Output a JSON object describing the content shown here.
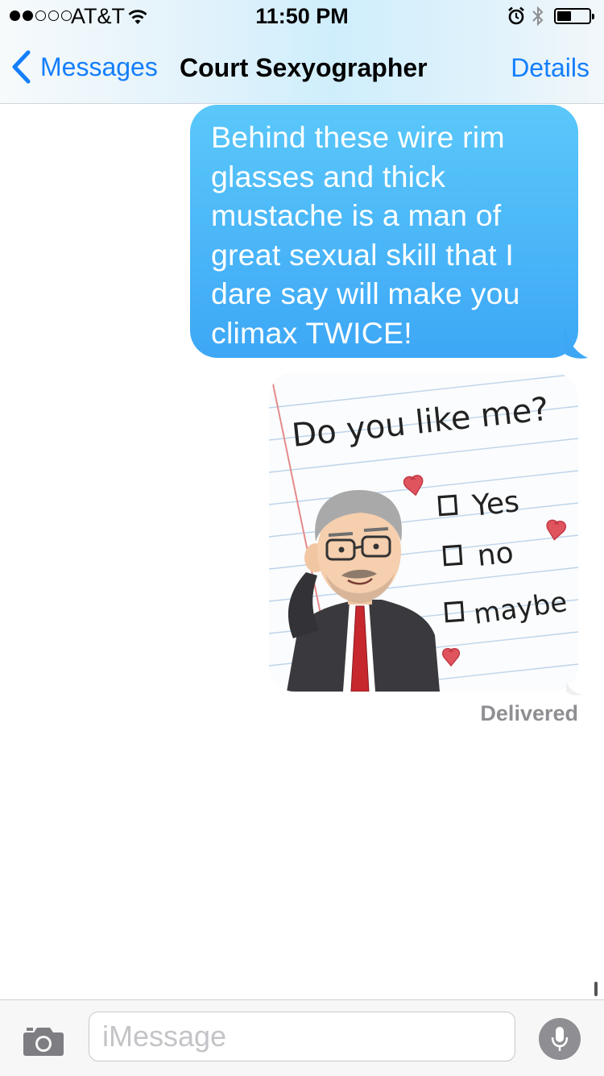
{
  "status_bar": {
    "carrier": "AT&T",
    "signal_bars": 2,
    "signal_total": 5,
    "time": "11:50 PM",
    "battery_level": 0.45,
    "icons": [
      "wifi-icon",
      "alarm-icon",
      "bluetooth-icon",
      "battery-icon"
    ]
  },
  "nav": {
    "back_label": "Messages",
    "title": "Court Sexyographer",
    "details_label": "Details"
  },
  "messages": [
    {
      "type": "text",
      "direction": "outgoing",
      "lines": [
        "Behind these wire rim",
        "glasses and thick",
        "mustache is a man of",
        "great sexual skill that I",
        "dare say will make you",
        "climax TWICE!"
      ]
    },
    {
      "type": "sticker",
      "direction": "outgoing",
      "sticker": {
        "heading": "Do you like me?",
        "options": [
          "Yes",
          "no",
          "maybe"
        ]
      }
    }
  ],
  "delivery_status": "Delivered",
  "input": {
    "placeholder": "iMessage",
    "value": ""
  },
  "colors": {
    "accent": "#147efb",
    "bubble_top": "#5ac8fa",
    "bubble_bottom": "#3da7f6",
    "mic_button": "#8e8e93"
  }
}
